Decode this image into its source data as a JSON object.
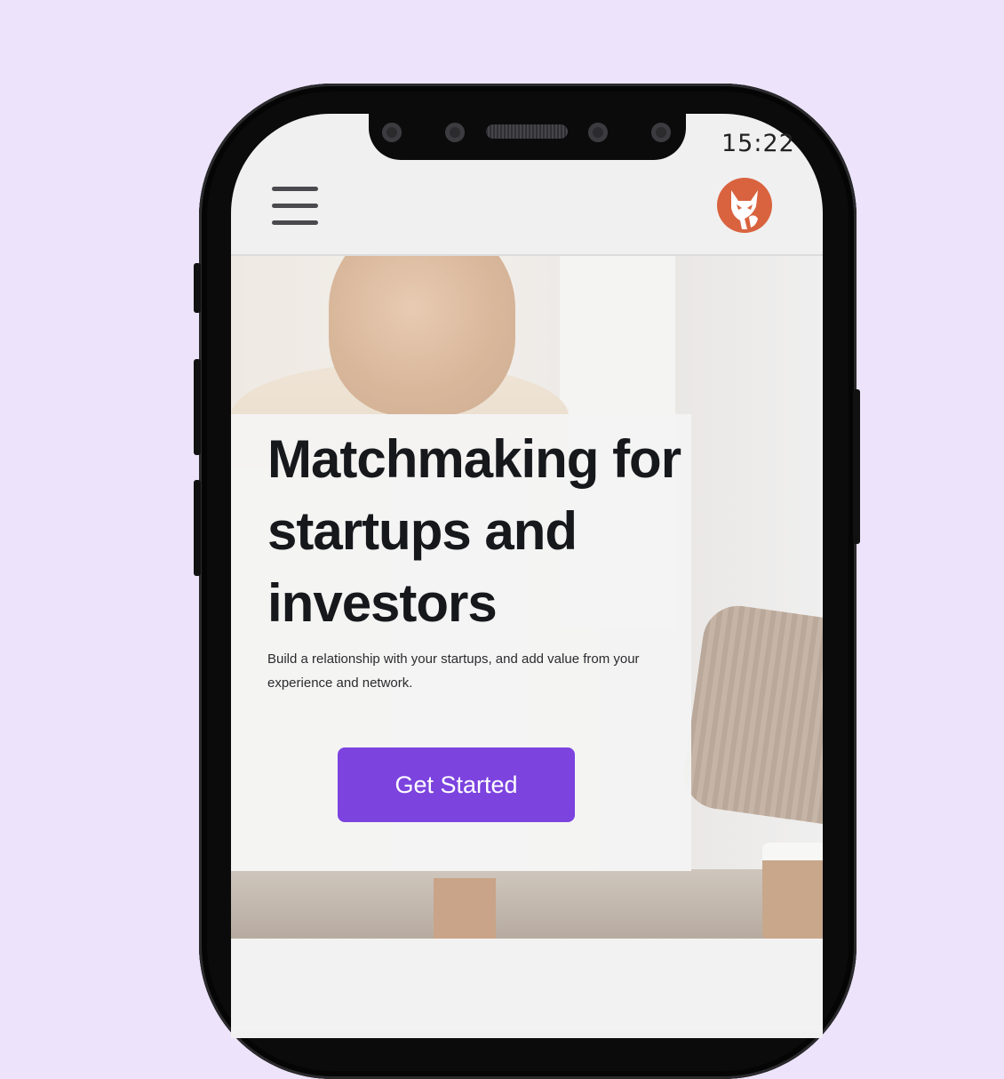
{
  "status_bar": {
    "time": "15:22"
  },
  "header": {
    "menu_icon": "hamburger-menu-icon",
    "logo_icon": "fox-logo-icon",
    "logo_color": "#d9633f"
  },
  "hero": {
    "headline": "Matchmaking for startups and investors",
    "subtext": "Build a relationship with your startups, and add value from your experience and network.",
    "cta_label": "Get Started",
    "cta_color": "#7c43df"
  },
  "page_background": "#ede3fb"
}
